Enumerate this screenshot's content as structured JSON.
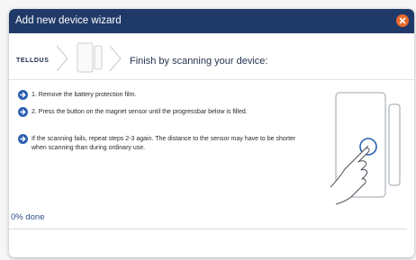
{
  "dialog": {
    "title": "Add new device wizard",
    "close_icon": "close-icon",
    "colors": {
      "titlebar": "#1f3a68",
      "close_button": "#e8692c",
      "accent": "#2a5fb0"
    }
  },
  "header": {
    "brand": "TELLDUS",
    "device_icon": "door-sensor-icon",
    "step_title": "Finish by scanning your device:"
  },
  "instructions": [
    {
      "text": "1. Remove the battery protection film.",
      "icon": "arrow-right-circle-icon"
    },
    {
      "text": "2. Press the button on the magnet sensor until the progressbar below is filled.",
      "icon": "arrow-right-circle-icon"
    },
    {
      "text": "If the scanning fails, repeat steps 2-3 again. The distance to the sensor may have to be shorter",
      "text_line2": "when scanning than during ordinary use.",
      "icon": "arrow-right-circle-icon"
    }
  ],
  "illustration": {
    "icon": "hand-pressing-sensor-icon"
  },
  "progress": {
    "label": "0% done",
    "fraction": 0.0
  }
}
